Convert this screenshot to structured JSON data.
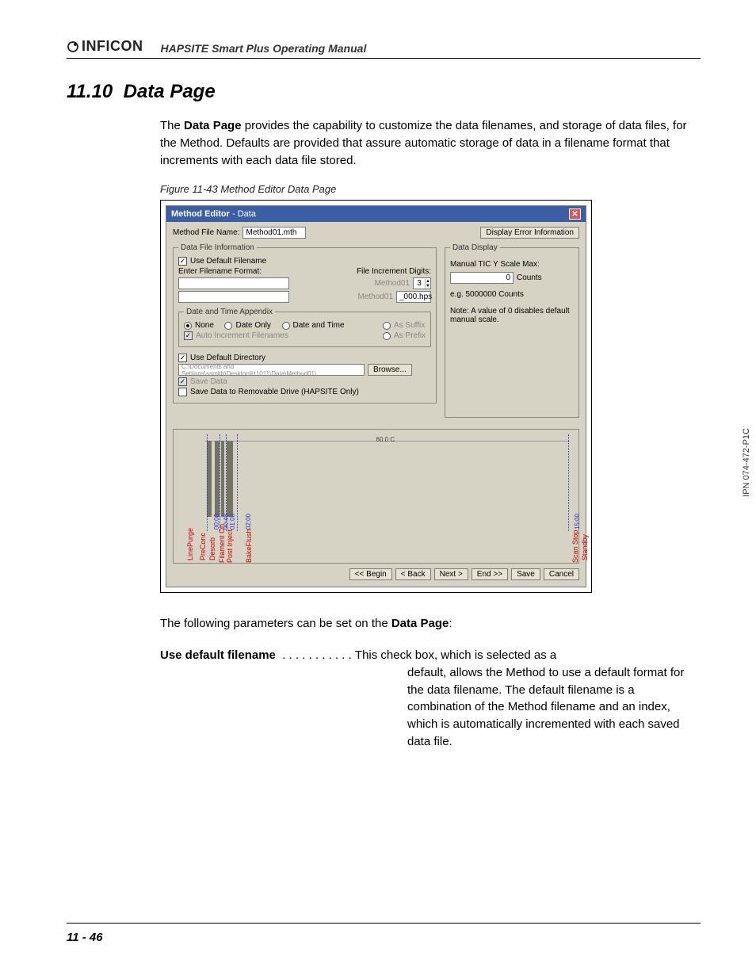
{
  "header": {
    "brand": "INFICON",
    "manual_title": "HAPSITE Smart Plus Operating Manual"
  },
  "section": {
    "number": "11.10",
    "title": "Data Page"
  },
  "intro": {
    "p1_a": "The ",
    "p1_b": "Data Page",
    "p1_c": " provides the capability to customize the data filenames, and storage of data files, for the Method. Defaults are provided that assure automatic storage of data in a filename format that increments with each data file stored."
  },
  "figure_caption": "Figure 11-43  Method Editor Data Page",
  "win": {
    "title_a": "Method Editor",
    "title_sep": " - ",
    "title_b": "Data",
    "method_file_label": "Method File Name:",
    "method_file_value": "Method01.mth",
    "display_error_btn": "Display Error Information",
    "group_dfi": "Data File Information",
    "use_default_filename": "Use Default Filename",
    "enter_format": "Enter Filename Format:",
    "file_inc_digits": "File Increment Digits:",
    "spin_val": "3",
    "preview1_left": "Method01",
    "preview2_left": "Method01",
    "preview2_right": "_000.hps",
    "group_dta": "Date and Time Appendix",
    "r_none": "None",
    "r_dateonly": "Date Only",
    "r_datetime": "Date and Time",
    "as_suffix": "As Suffix",
    "as_prefix": "As Prefix",
    "auto_inc": "Auto Increment Filenames",
    "use_default_dir": "Use Default Directory",
    "dir_path": "C:\\Documents and Settings\\ssmith\\Desktop\\H1011\\Data\\Method01\\",
    "browse": "Browse...",
    "save_data": "Save Data",
    "save_removable": "Save Data to Removable Drive (HAPSITE Only)",
    "group_dd": "Data Display",
    "manual_tic": "Manual TIC Y Scale Max:",
    "tic_value": "0",
    "counts": "Counts",
    "eg": "e.g. 5000000  Counts",
    "note": "Note:  A value of 0 disables default manual scale.",
    "tl_temp": "60.0 C",
    "tl_labels": [
      "LinePurge",
      "PreConc",
      "Desorb",
      "Filament On",
      "Post Inject",
      "BakeFlush"
    ],
    "tl_right1": "Scan Stop",
    "tl_right2": "Standby",
    "tl_times": [
      "00:00",
      "00:48",
      "01:00",
      "02:00",
      "15:00"
    ],
    "nav": [
      "<< Begin",
      "< Back",
      "Next >",
      "End >>",
      "Save",
      "Cancel"
    ]
  },
  "followup_a": "The following parameters can be set on the ",
  "followup_b": "Data Page",
  "followup_c": ":",
  "param": {
    "term": "Use default filename",
    "dots": "  . . . . . . . . . . . ",
    "d1": "This check box, which is selected as a",
    "d2": "default, allows the Method to use a default format for the data filename. The default filename is a combination of the Method filename and an index, which is automatically incremented with each saved data file."
  },
  "side_note": "IPN 074-472-P1C",
  "page_number": "11 - 46"
}
